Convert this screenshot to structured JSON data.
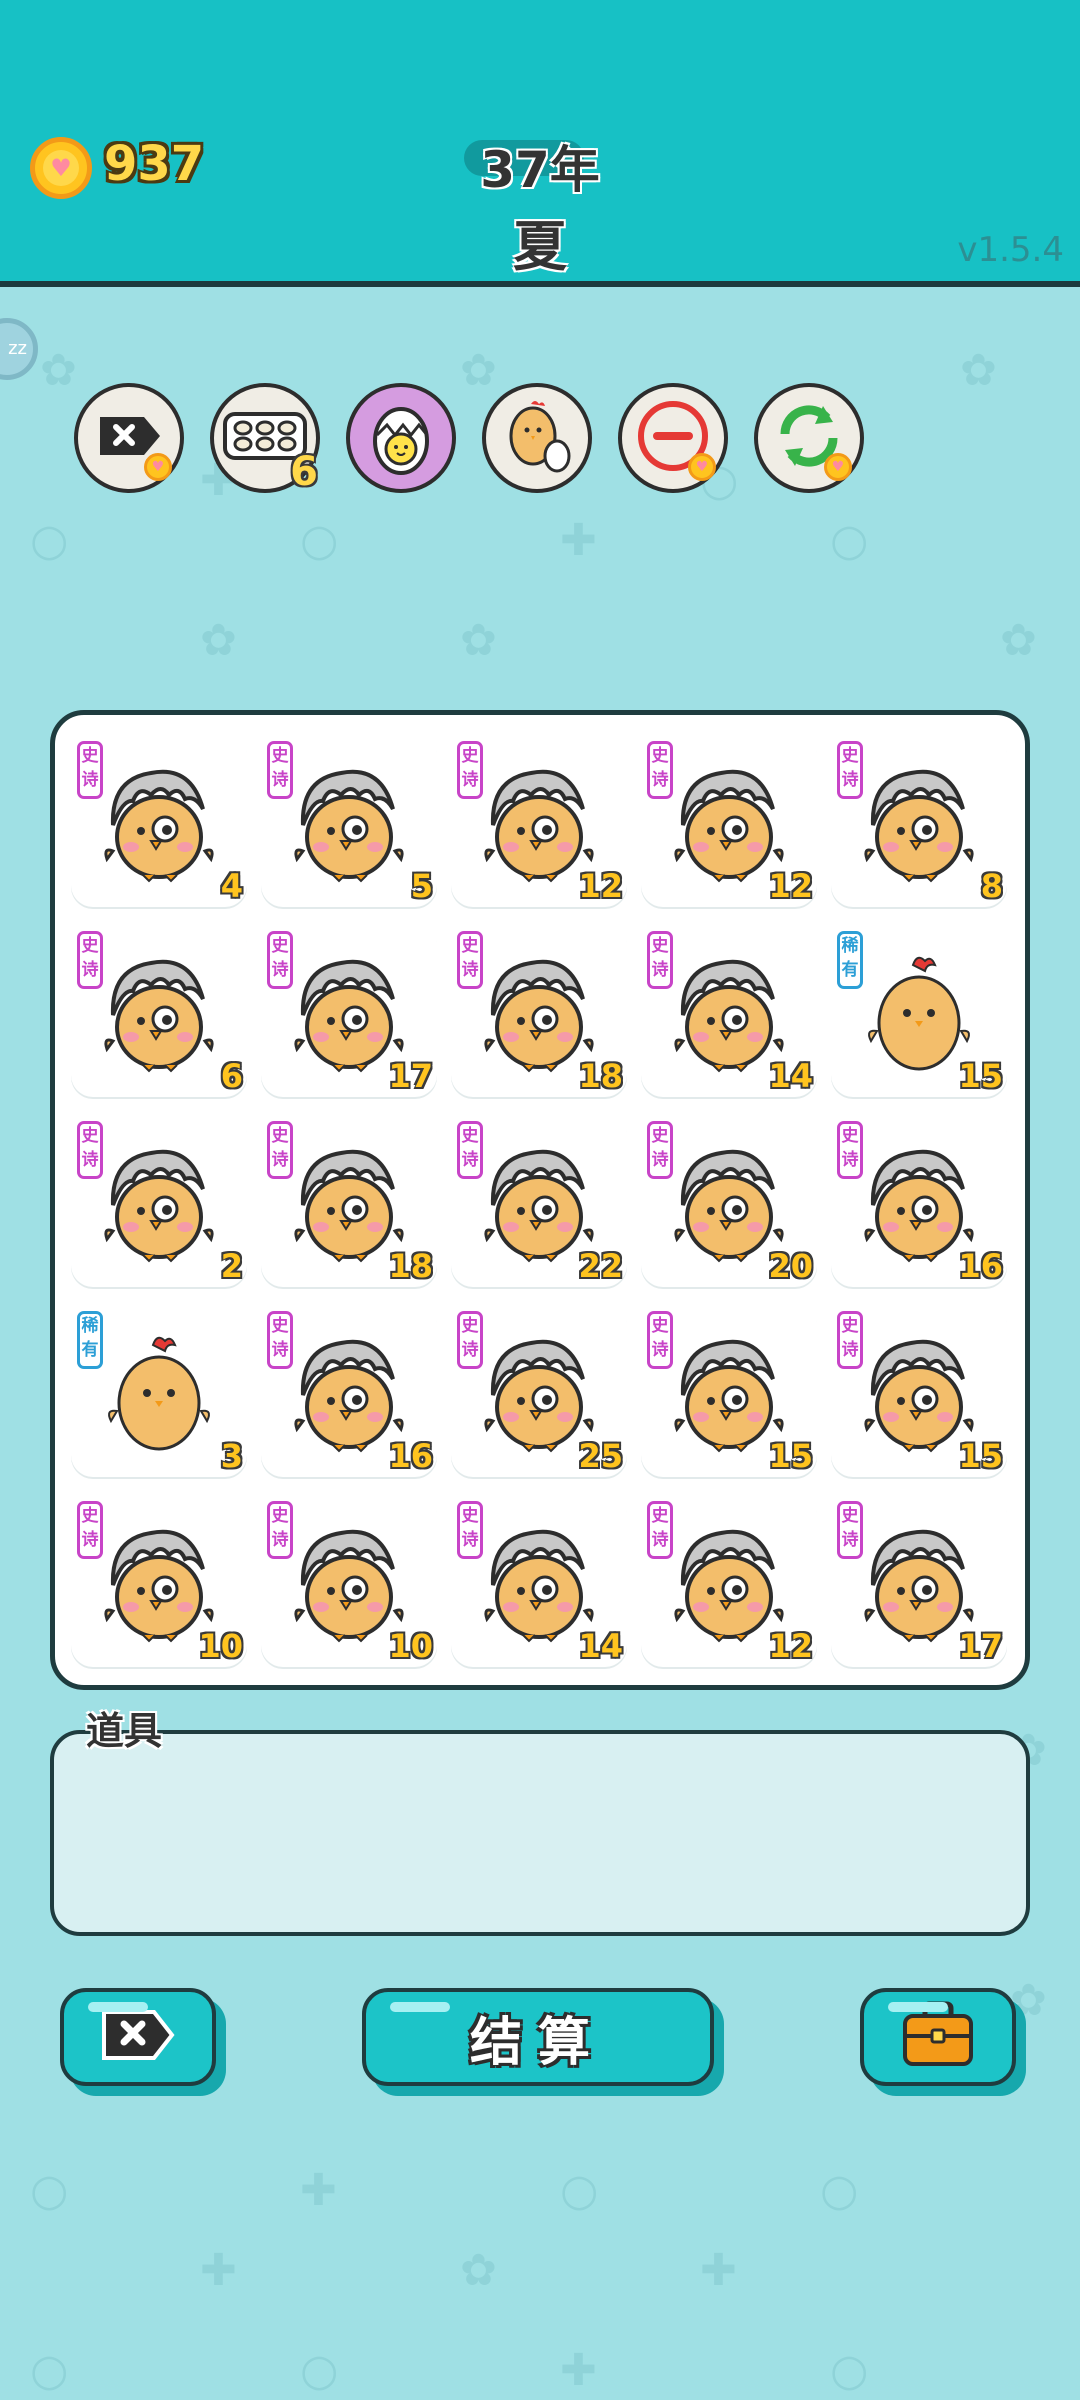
{
  "header": {
    "coins": "937",
    "year": "37年",
    "season": "夏",
    "version": "v1.5.4"
  },
  "powerups": [
    {
      "name": "discard-card-icon",
      "badge": "heart"
    },
    {
      "name": "egg-tray-icon",
      "badge": "6"
    },
    {
      "name": "hatching-egg-icon",
      "badge": ""
    },
    {
      "name": "chick-with-egg-icon",
      "badge": ""
    },
    {
      "name": "minus-icon",
      "badge": "heart"
    },
    {
      "name": "refresh-icon",
      "badge": "heart"
    }
  ],
  "grid": {
    "rows": [
      [
        {
          "tag": "史诗",
          "rarity": "epic",
          "value": "4"
        },
        {
          "tag": "史诗",
          "rarity": "epic",
          "value": "5"
        },
        {
          "tag": "史诗",
          "rarity": "epic",
          "value": "12"
        },
        {
          "tag": "史诗",
          "rarity": "epic",
          "value": "12"
        },
        {
          "tag": "史诗",
          "rarity": "epic",
          "value": "8"
        }
      ],
      [
        {
          "tag": "史诗",
          "rarity": "epic",
          "value": "6"
        },
        {
          "tag": "史诗",
          "rarity": "epic",
          "value": "17"
        },
        {
          "tag": "史诗",
          "rarity": "epic",
          "value": "18"
        },
        {
          "tag": "史诗",
          "rarity": "epic",
          "value": "14"
        },
        {
          "tag": "稀有",
          "rarity": "rare",
          "value": "15"
        }
      ],
      [
        {
          "tag": "史诗",
          "rarity": "epic",
          "value": "2"
        },
        {
          "tag": "史诗",
          "rarity": "epic",
          "value": "18"
        },
        {
          "tag": "史诗",
          "rarity": "epic",
          "value": "22"
        },
        {
          "tag": "史诗",
          "rarity": "epic",
          "value": "20"
        },
        {
          "tag": "史诗",
          "rarity": "epic",
          "value": "16"
        }
      ],
      [
        {
          "tag": "稀有",
          "rarity": "rare",
          "value": "3"
        },
        {
          "tag": "史诗",
          "rarity": "epic",
          "value": "16"
        },
        {
          "tag": "史诗",
          "rarity": "epic",
          "value": "25"
        },
        {
          "tag": "史诗",
          "rarity": "epic",
          "value": "15"
        },
        {
          "tag": "史诗",
          "rarity": "epic",
          "value": "15"
        }
      ],
      [
        {
          "tag": "史诗",
          "rarity": "epic",
          "value": "10"
        },
        {
          "tag": "史诗",
          "rarity": "epic",
          "value": "10"
        },
        {
          "tag": "史诗",
          "rarity": "epic",
          "value": "14"
        },
        {
          "tag": "史诗",
          "rarity": "epic",
          "value": "12"
        },
        {
          "tag": "史诗",
          "rarity": "epic",
          "value": "17"
        }
      ]
    ]
  },
  "tools": {
    "label": "道具"
  },
  "buttons": {
    "settle_label": "结算"
  },
  "colors": {
    "header": "#17c1c5",
    "background": "#9fe0e4",
    "epic_tag": "#c844c8",
    "rare_tag": "#2c9fd6",
    "value_text": "#ffc41f"
  }
}
